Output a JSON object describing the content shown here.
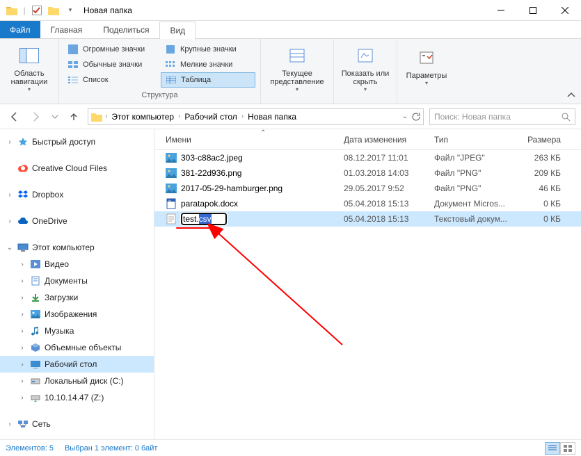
{
  "window": {
    "title": "Новая папка"
  },
  "tabs": {
    "file": "Файл",
    "home": "Главная",
    "share": "Поделиться",
    "view": "Вид"
  },
  "ribbon": {
    "group1": {
      "nav_pane": "Область навигации",
      "label": ""
    },
    "group2": {
      "items": {
        "huge": "Огромные значки",
        "large": "Крупные значки",
        "medium": "Обычные значки",
        "small": "Мелкие значки",
        "list": "Список",
        "table": "Таблица"
      },
      "label": "Структура"
    },
    "group3": {
      "current_view": "Текущее представление",
      "show_hide": "Показать или скрыть",
      "options": "Параметры"
    }
  },
  "breadcrumb": {
    "root": "Этот компьютер",
    "desktop": "Рабочий стол",
    "folder": "Новая папка"
  },
  "search": {
    "placeholder": "Поиск: Новая папка"
  },
  "columns": {
    "name": "Имени",
    "date": "Дата изменения",
    "type": "Тип",
    "size": "Размера"
  },
  "tree": {
    "quick": "Быстрый доступ",
    "ccf": "Creative Cloud Files",
    "dropbox": "Dropbox",
    "onedrive": "OneDrive",
    "this_pc": "Этот компьютер",
    "videos": "Видео",
    "documents": "Документы",
    "downloads": "Загрузки",
    "pictures": "Изображения",
    "music": "Музыка",
    "objects3d": "Объемные объекты",
    "desktop": "Рабочий стол",
    "local_disk": "Локальный диск (C:)",
    "net_drive": "10.10.14.47 (Z:)",
    "network": "Сеть"
  },
  "files": [
    {
      "name": "303-c88ac2.jpeg",
      "date": "08.12.2017 11:01",
      "type": "Файл \"JPEG\"",
      "size": "263 КБ",
      "icon": "img"
    },
    {
      "name": "381-22d936.png",
      "date": "01.03.2018 14:03",
      "type": "Файл \"PNG\"",
      "size": "209 КБ",
      "icon": "img"
    },
    {
      "name": "2017-05-29-hamburger.png",
      "date": "29.05.2017 9:52",
      "type": "Файл \"PNG\"",
      "size": "46 КБ",
      "icon": "img"
    },
    {
      "name": "paratapok.docx",
      "date": "05.04.2018 15:13",
      "type": "Документ Micros...",
      "size": "0 КБ",
      "icon": "doc"
    },
    {
      "name": "test.csv",
      "date": "05.04.2018 15:13",
      "type": "Текстовый докум...",
      "size": "0 КБ",
      "icon": "txt",
      "renaming": true
    }
  ],
  "rename_value": "test.csv",
  "status": {
    "count": "Элементов: 5",
    "selected": "Выбран 1 элемент: 0 байт"
  }
}
